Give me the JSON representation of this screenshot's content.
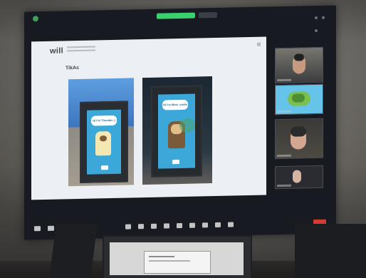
{
  "slide": {
    "brand": "will",
    "title": "TikAs"
  },
  "posters": {
    "left_caption": "Hi I'm Theodor :)",
    "right_caption": "Hi I'm Maxi_cards"
  }
}
